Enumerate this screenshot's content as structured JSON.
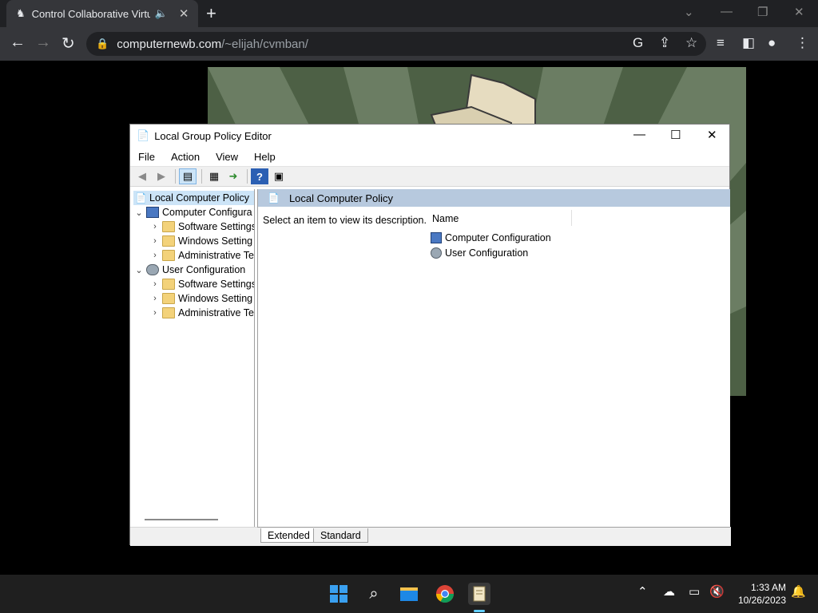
{
  "browser": {
    "tab_title": "Control Collaborative Virtua",
    "url_host": "computernewb.com",
    "url_path": "/~elijah/cvmban/"
  },
  "gp_window": {
    "title": "Local Group Policy Editor",
    "menu": [
      "File",
      "Action",
      "View",
      "Help"
    ],
    "tree": {
      "root": "Local Computer Policy",
      "computer_config": "Computer Configura",
      "computer_children": [
        "Software Settings",
        "Windows Setting",
        "Administrative Te"
      ],
      "user_config": "User Configuration",
      "user_children": [
        "Software Settings",
        "Windows Setting",
        "Administrative Te"
      ]
    },
    "right_pane": {
      "header": "Local Computer Policy",
      "description": "Select an item to view its description.",
      "column_name": "Name",
      "items": [
        "Computer Configuration",
        "User Configuration"
      ]
    },
    "tabs": [
      "Extended",
      "Standard"
    ]
  },
  "taskbar": {
    "time": "1:33 AM",
    "date": "10/26/2023"
  },
  "colors": {
    "chrome_bg": "#202124",
    "toolbar_bg": "#35363a",
    "selection": "#cce4f7",
    "pane_header": "#b7c9de",
    "taskbar": "#1f1f1f"
  }
}
